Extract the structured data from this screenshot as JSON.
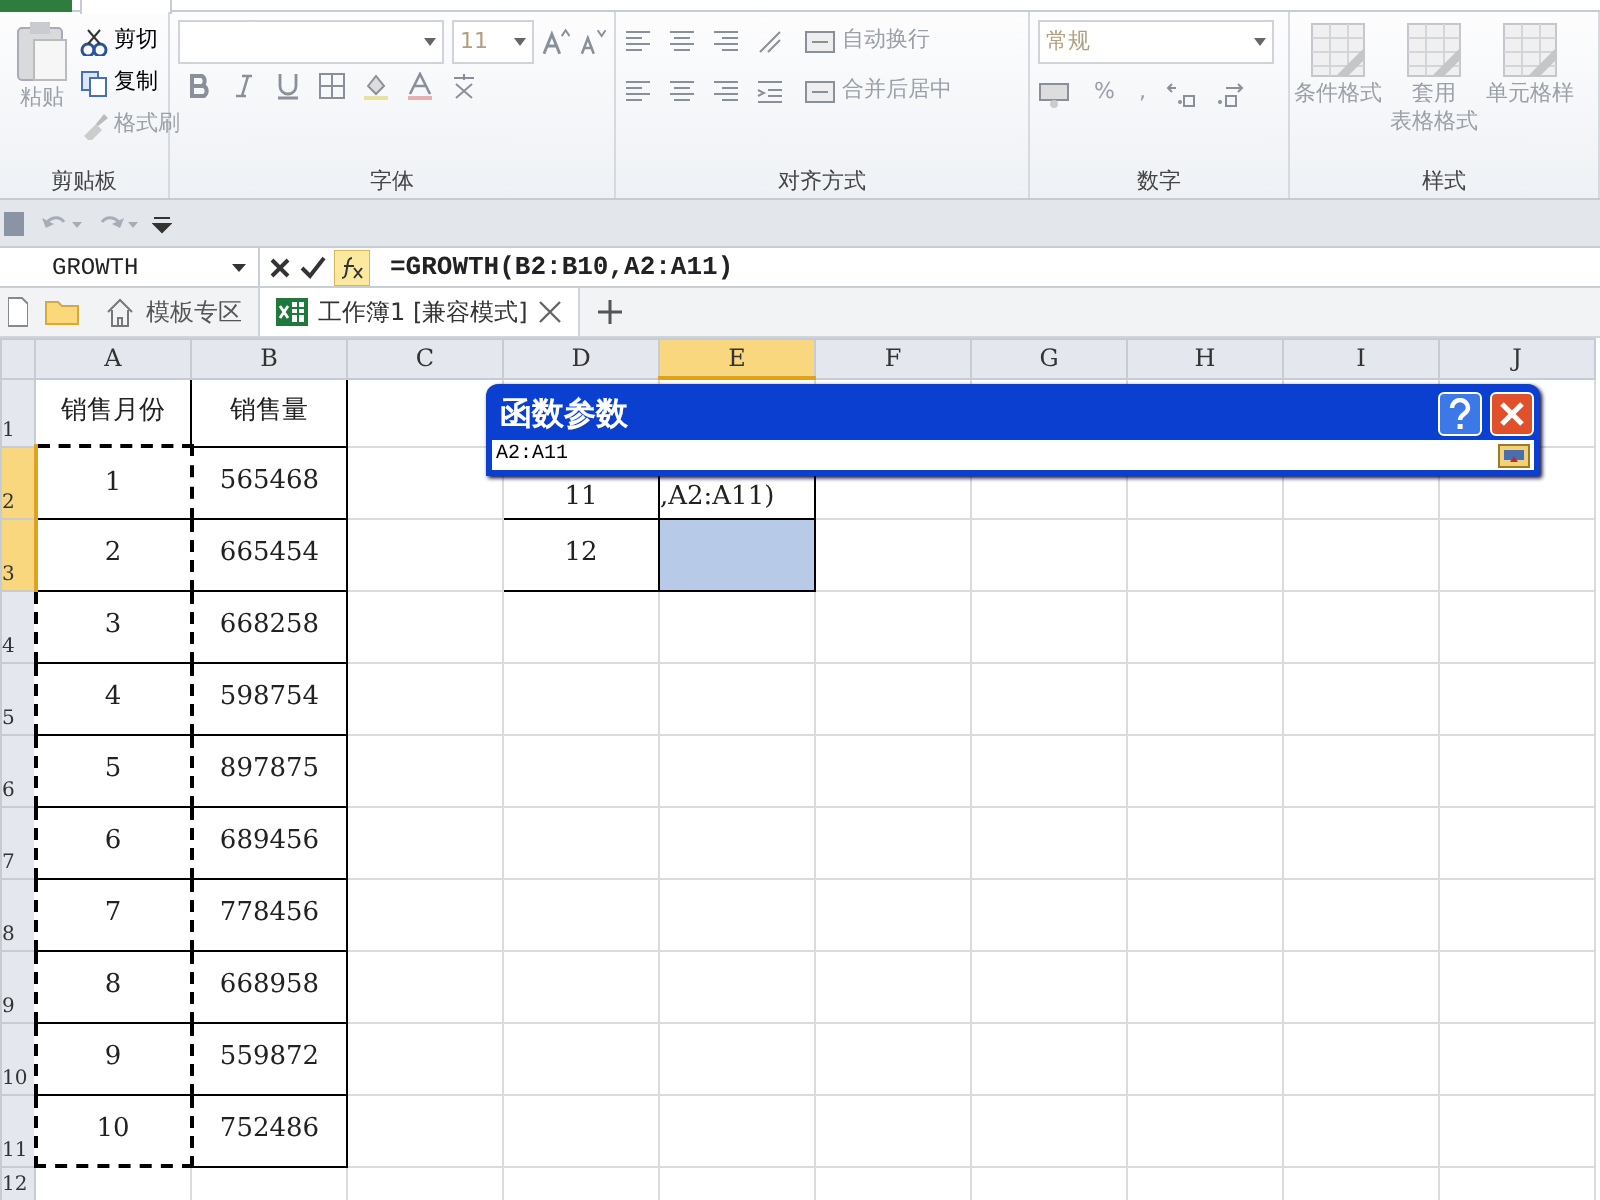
{
  "ribbon": {
    "groups": [
      {
        "label": "剪贴板",
        "disabled": false,
        "buttons": [
          {
            "label": "粘贴",
            "disabled": true
          },
          {
            "label": "剪切",
            "disabled": false
          },
          {
            "label": "复制",
            "disabled": false
          },
          {
            "label": "格式刷",
            "disabled": true
          }
        ]
      },
      {
        "label": "字体",
        "disabled": true,
        "size": "11"
      },
      {
        "label": "对齐方式",
        "disabled": true,
        "buttons": [
          {
            "label": "自动换行"
          },
          {
            "label": "合并后居中"
          }
        ]
      },
      {
        "label": "数字",
        "disabled": true,
        "format": "常规",
        "buttons": [
          {
            "label": "%"
          },
          {
            "label": ","
          }
        ]
      },
      {
        "label": "样式",
        "disabled": true,
        "buttons": [
          {
            "lines": [
              "条件格式"
            ]
          },
          {
            "lines": [
              "套用",
              "表格格式"
            ]
          },
          {
            "lines": [
              "单元格样"
            ]
          }
        ]
      }
    ]
  },
  "formula_bar": {
    "name_box": "GROWTH",
    "formula": "=GROWTH(B2:B10,A2:A11)"
  },
  "doc_tabs": [
    {
      "label": "模板专区",
      "selected": false,
      "closable": false
    },
    {
      "label": "工作簿1  [兼容模式]",
      "selected": true,
      "closable": true
    }
  ],
  "sheet": {
    "columns": [
      {
        "label": "A",
        "selected": false
      },
      {
        "label": "B",
        "selected": false
      },
      {
        "label": "C",
        "selected": false
      },
      {
        "label": "D",
        "selected": false
      },
      {
        "label": "E",
        "selected": true
      },
      {
        "label": "F",
        "selected": false
      },
      {
        "label": "G",
        "selected": false
      },
      {
        "label": "H",
        "selected": false
      },
      {
        "label": "I",
        "selected": false
      },
      {
        "label": "J",
        "selected": false
      }
    ],
    "rows": [
      {
        "label": "1",
        "selected": false,
        "cells": [
          {
            "text": "销售月份",
            "boxed": true
          },
          {
            "text": "销售量",
            "boxed": true
          }
        ]
      },
      {
        "label": "2",
        "selected": true,
        "cells": [
          {
            "text": "1",
            "boxed": true,
            "marquee": true
          },
          {
            "text": "565468",
            "boxed": true
          },
          {},
          {
            "text": "11",
            "boxed": true
          },
          {
            "text": ",A2:A11)",
            "boxed": true
          }
        ]
      },
      {
        "label": "3",
        "selected": true,
        "cells": [
          {
            "text": "2",
            "boxed": true,
            "marquee": true
          },
          {
            "text": "665454",
            "boxed": true
          },
          {},
          {
            "text": "12",
            "boxed": true
          },
          {
            "boxed": true,
            "selected": true
          }
        ]
      },
      {
        "label": "4",
        "selected": false,
        "cells": [
          {
            "text": "3",
            "boxed": true,
            "marquee": true
          },
          {
            "text": "668258",
            "boxed": true
          }
        ]
      },
      {
        "label": "5",
        "selected": false,
        "cells": [
          {
            "text": "4",
            "boxed": true,
            "marquee": true
          },
          {
            "text": "598754",
            "boxed": true
          }
        ]
      },
      {
        "label": "6",
        "selected": false,
        "cells": [
          {
            "text": "5",
            "boxed": true,
            "marquee": true
          },
          {
            "text": "897875",
            "boxed": true
          }
        ]
      },
      {
        "label": "7",
        "selected": false,
        "cells": [
          {
            "text": "6",
            "boxed": true,
            "marquee": true
          },
          {
            "text": "689456",
            "boxed": true
          }
        ]
      },
      {
        "label": "8",
        "selected": false,
        "cells": [
          {
            "text": "7",
            "boxed": true,
            "marquee": true
          },
          {
            "text": "778456",
            "boxed": true
          }
        ]
      },
      {
        "label": "9",
        "selected": false,
        "cells": [
          {
            "text": "8",
            "boxed": true,
            "marquee": true
          },
          {
            "text": "668958",
            "boxed": true
          }
        ]
      },
      {
        "label": "10",
        "selected": false,
        "cells": [
          {
            "text": "9",
            "boxed": true,
            "marquee": true
          },
          {
            "text": "559872",
            "boxed": true
          }
        ]
      },
      {
        "label": "11",
        "selected": false,
        "cells": [
          {
            "text": "10",
            "boxed": true,
            "marquee": true
          },
          {
            "text": "752486",
            "boxed": true
          }
        ]
      },
      {
        "label": "12",
        "selected": false,
        "cells": []
      }
    ]
  },
  "dialog": {
    "title": "函数参数",
    "value": "A2:A11"
  }
}
